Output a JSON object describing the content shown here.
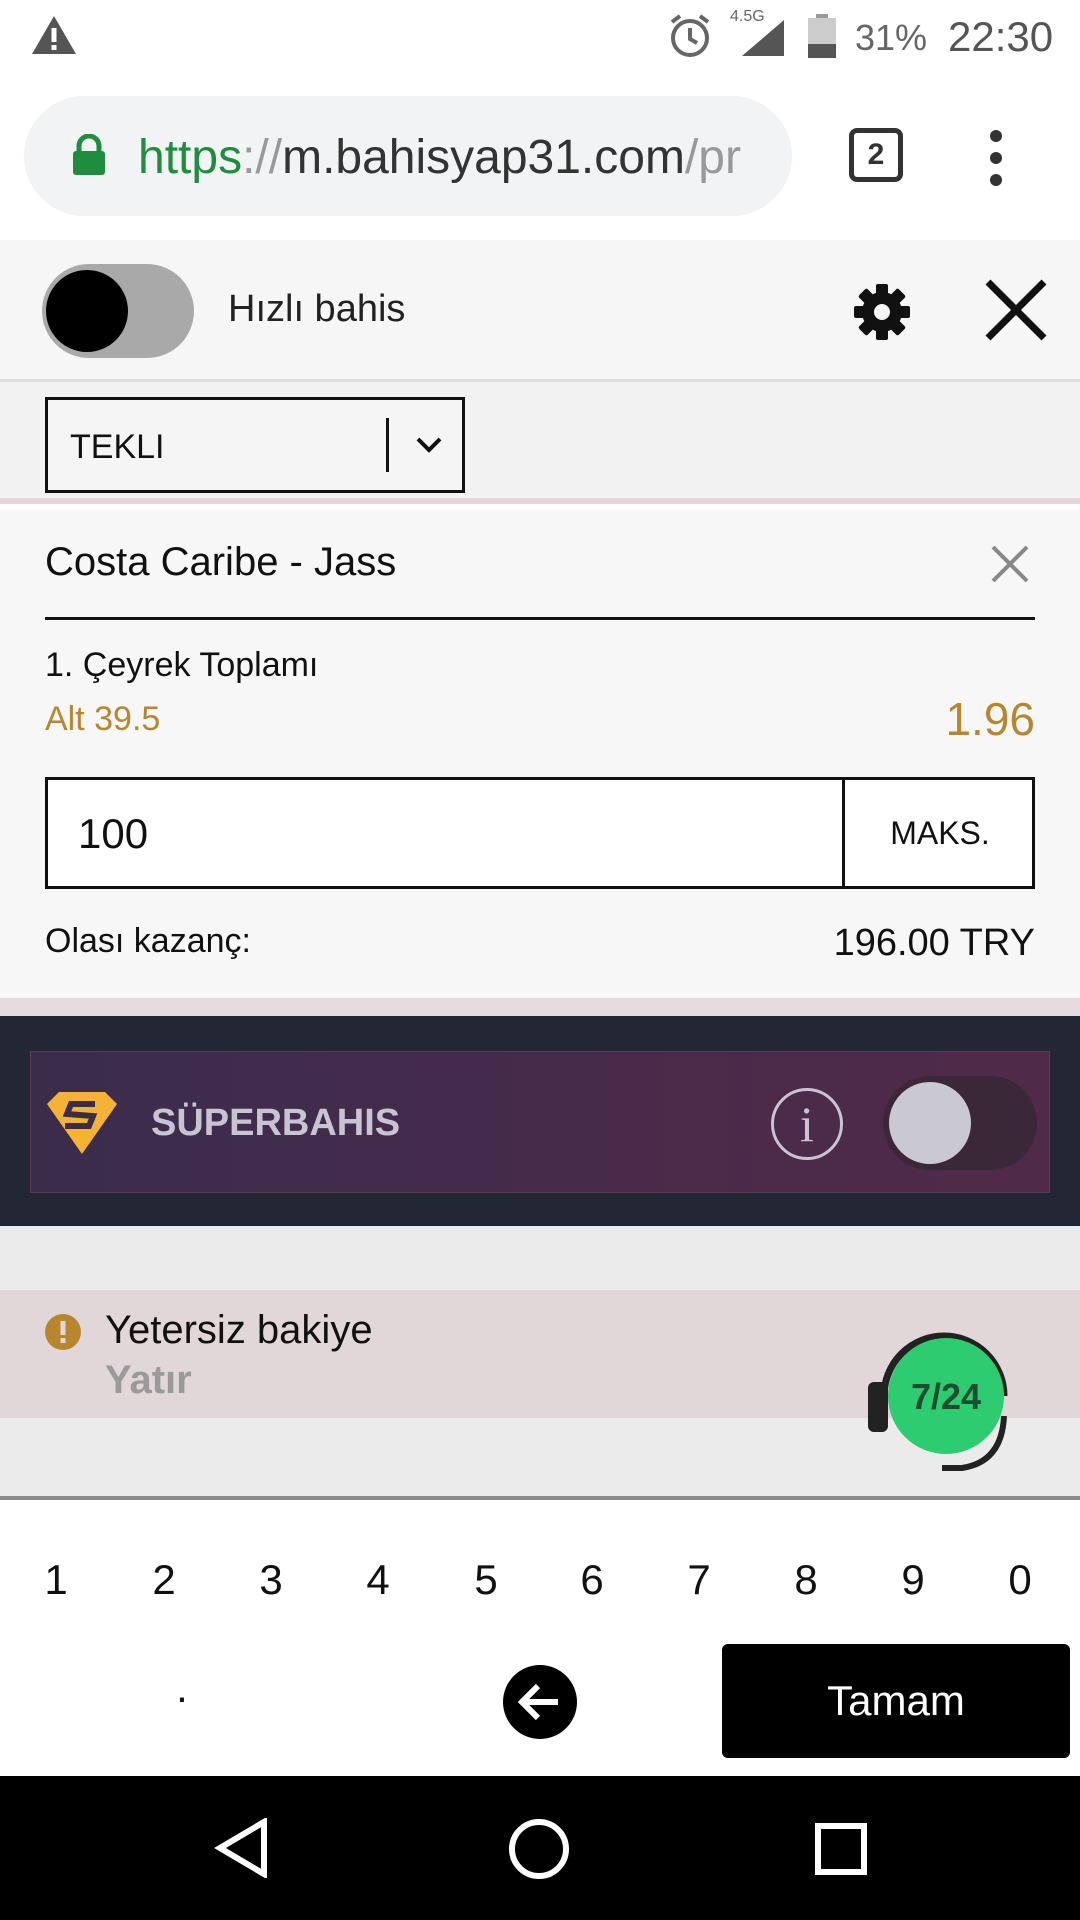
{
  "status_bar": {
    "network": "4.5G",
    "battery": "31%",
    "time": "22:30"
  },
  "browser": {
    "url_scheme": "https",
    "url_sep": "://",
    "url_host": "m.bahisyap31.com",
    "url_path": "/pr",
    "tab_count": "2"
  },
  "betslip": {
    "quick_bet_label": "Hızlı bahis",
    "bet_type": "TEKLI",
    "match": "Costa Caribe - Jass",
    "market": "1. Çeyrek Toplamı",
    "selection": "Alt 39.5",
    "odds": "1.96",
    "stake": "100",
    "max_label": "MAKS.",
    "winnings_label": "Olası kazanç:",
    "winnings_value": "196.00 TRY"
  },
  "superbahis": {
    "label": "SÜPERBAHIS",
    "info_glyph": "i"
  },
  "warning": {
    "title": "Yetersiz bakiye",
    "action": "Yatır",
    "support_badge": "7/24"
  },
  "keyboard": {
    "digits": [
      "1",
      "2",
      "3",
      "4",
      "5",
      "6",
      "7",
      "8",
      "9",
      "0"
    ],
    "dot": ".",
    "done": "Tamam"
  },
  "colors": {
    "accent_gold": "#b8862e",
    "url_green": "#1e8e3e",
    "superbahis_bg": "#232635",
    "support_green": "#2ecc71"
  }
}
